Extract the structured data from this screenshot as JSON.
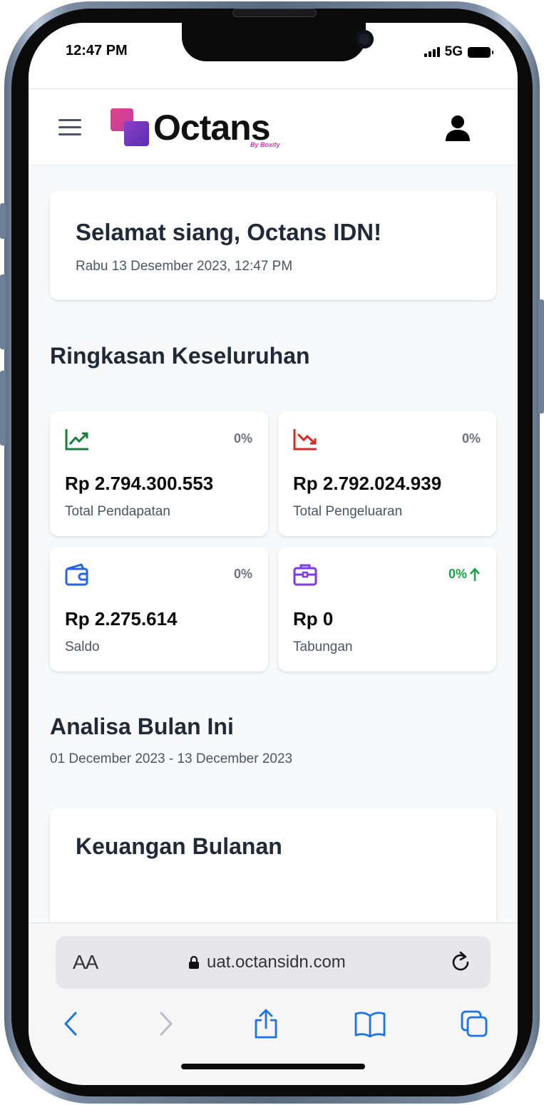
{
  "status_bar": {
    "time": "12:47 PM",
    "network": "5G",
    "icons": [
      "signal-icon",
      "battery-icon"
    ]
  },
  "header": {
    "menu_icon": "hamburger-menu-icon",
    "logo_text": "Octans",
    "logo_tagline": "By Boxity",
    "user_icon": "user-icon"
  },
  "greeting": {
    "title": "Selamat siang, Octans IDN!",
    "date": "Rabu 13 Desember 2023, 12:47 PM"
  },
  "summary": {
    "title": "Ringkasan Keseluruhan",
    "cards": [
      {
        "icon": "trending-up-icon",
        "icon_color": "#15803d",
        "percent": "0%",
        "value": "Rp 2.794.300.553",
        "label": "Total Pendapatan"
      },
      {
        "icon": "trending-down-icon",
        "icon_color": "#dc2626",
        "percent": "0%",
        "value": "Rp 2.792.024.939",
        "label": "Total Pengeluaran"
      },
      {
        "icon": "wallet-icon",
        "icon_color": "#2563eb",
        "percent": "0%",
        "value": "Rp 2.275.614",
        "label": "Saldo"
      },
      {
        "icon": "briefcase-icon",
        "icon_color": "#7c3aed",
        "percent": "0%",
        "percent_trend": "up",
        "percent_color": "#16a34a",
        "value": "Rp 0",
        "label": "Tabungan"
      }
    ]
  },
  "analysis": {
    "title": "Analisa Bulan Ini",
    "range": "01 December 2023 - 13 December 2023",
    "chart_card_title": "Keuangan Bulanan"
  },
  "browser": {
    "text_size_label": "AA",
    "url": "uat.octansidn.com",
    "icons": [
      "lock-icon",
      "reload-icon",
      "back-icon",
      "forward-icon",
      "share-icon",
      "bookmarks-icon",
      "tabs-icon"
    ],
    "accent": "#1a73e8"
  }
}
